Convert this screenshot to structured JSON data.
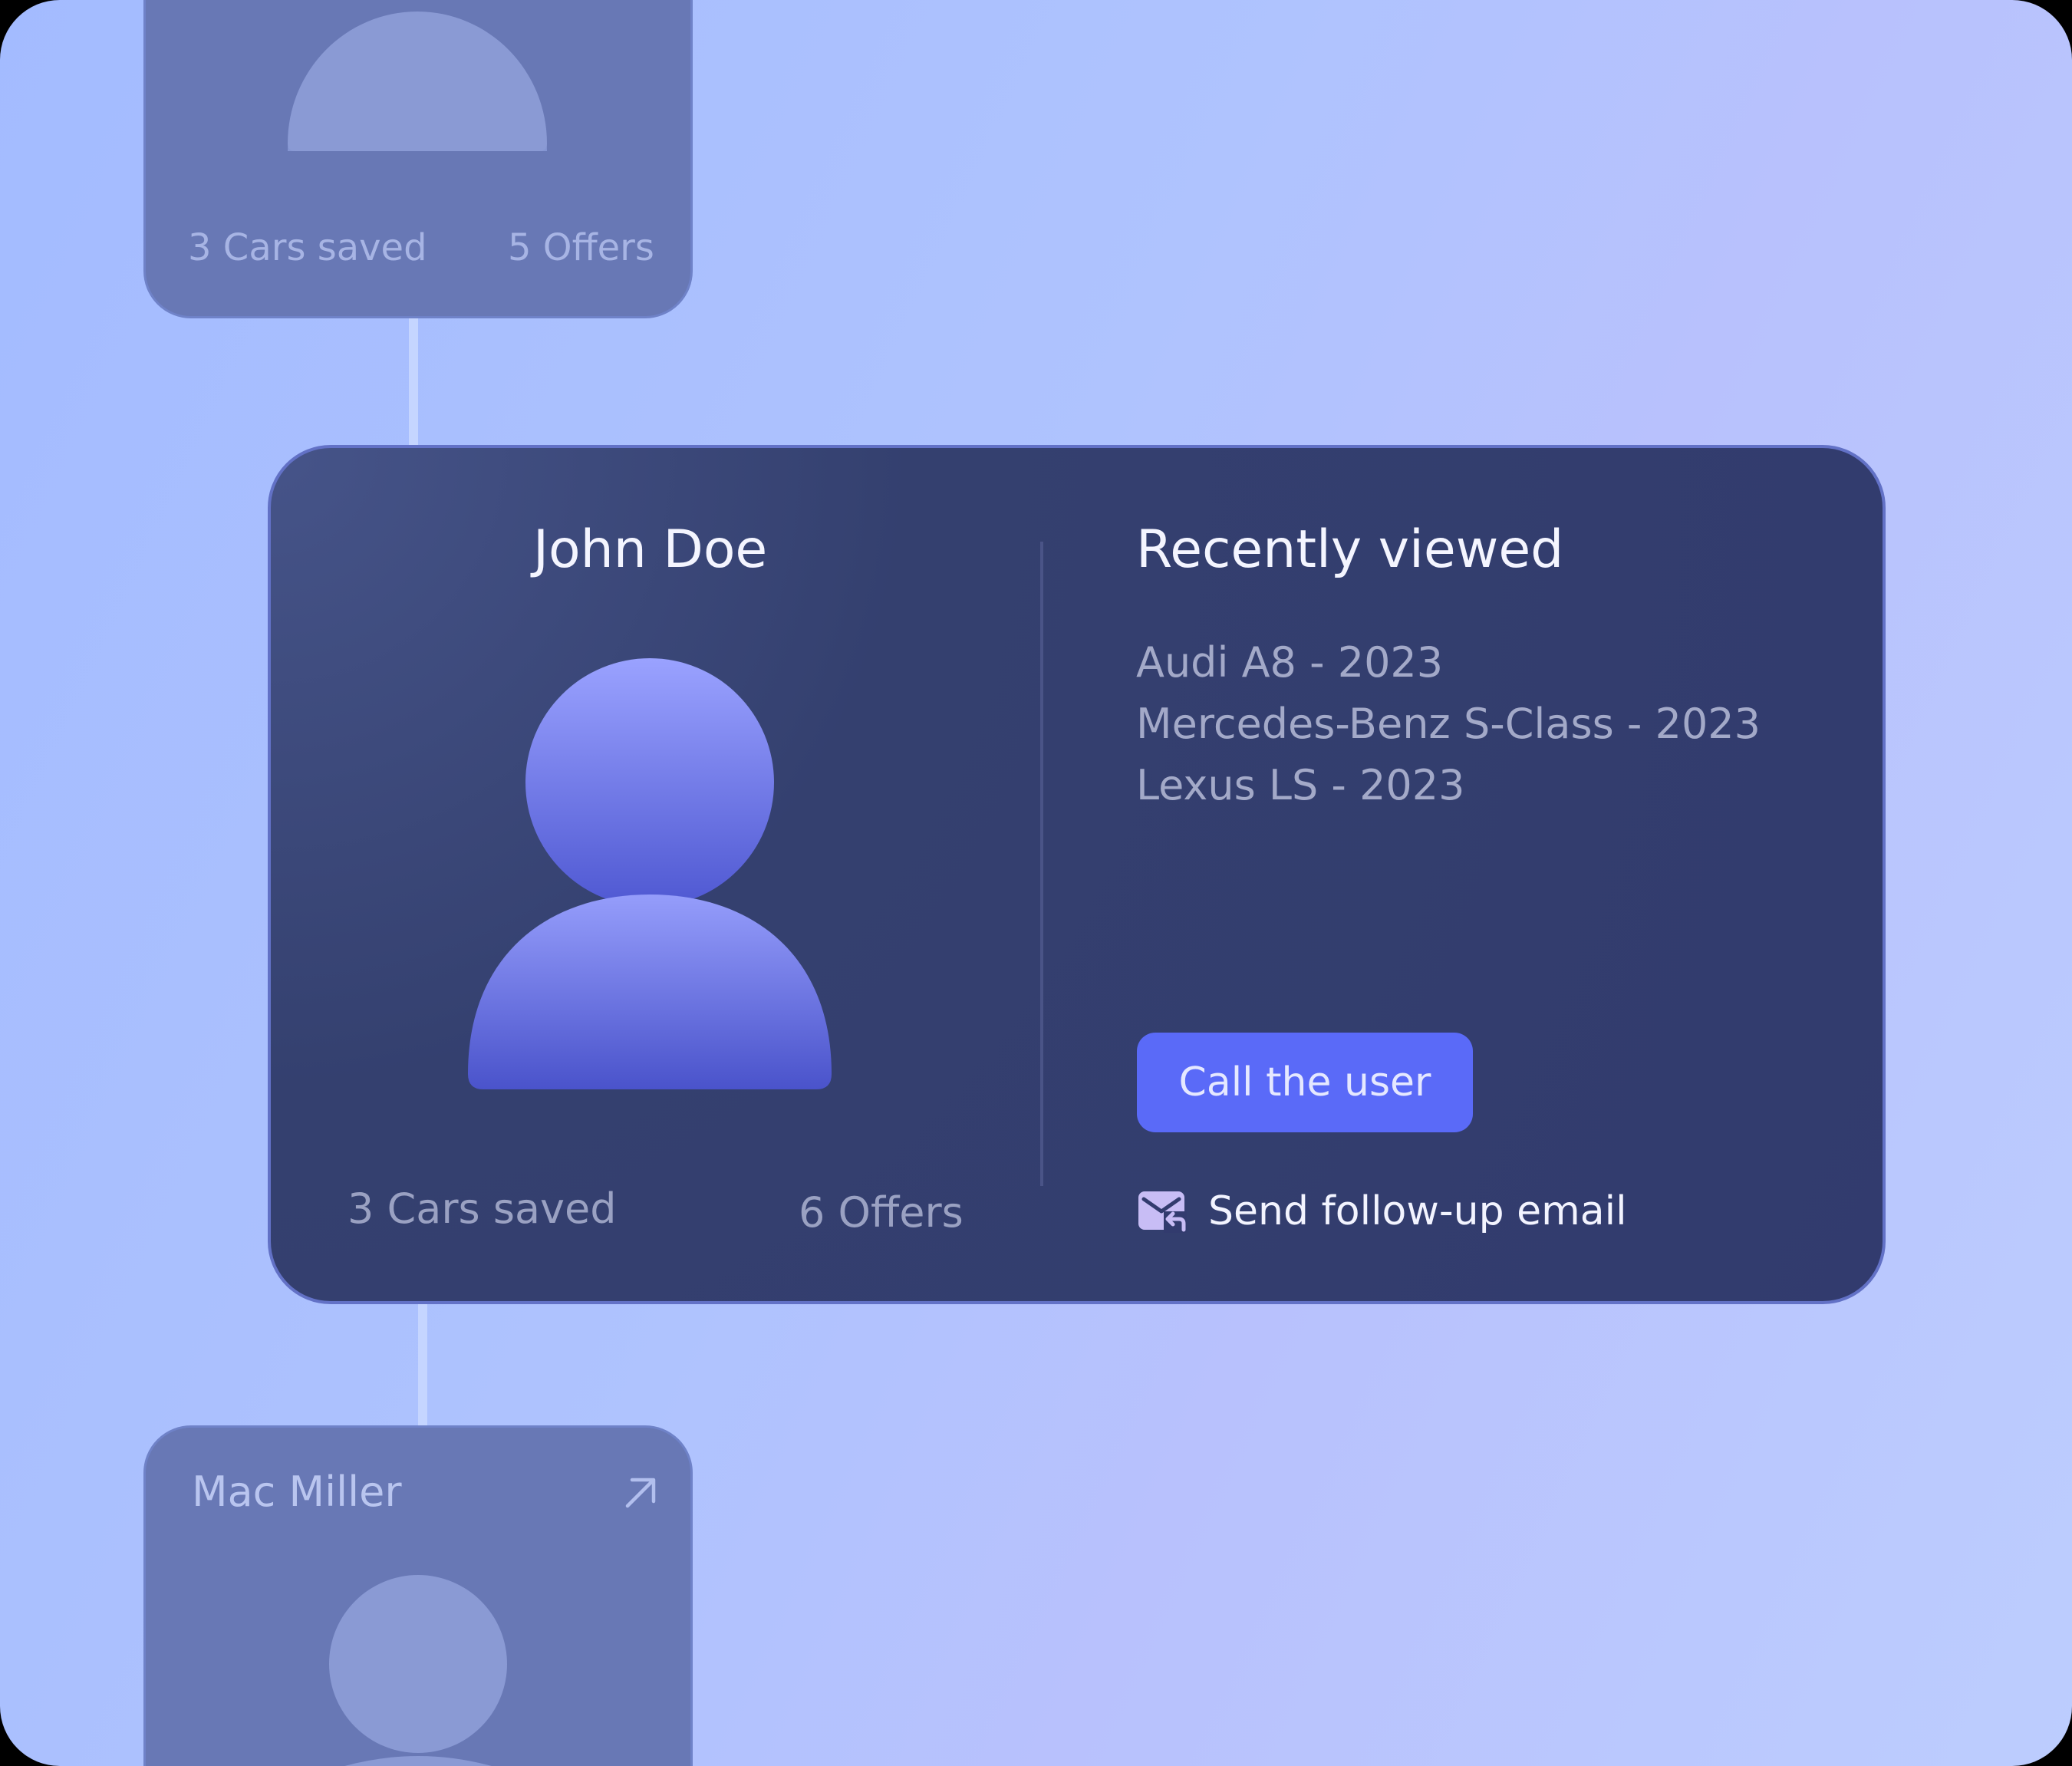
{
  "top_card": {
    "cars_saved": "3 Cars saved",
    "offers": "5 Offers"
  },
  "main_card": {
    "name": "John Doe",
    "cars_saved": "3 Cars saved",
    "offers": "6 Offers",
    "recently_viewed": {
      "title": "Recently viewed",
      "items": [
        "Audi A8 - 2023",
        "Mercedes-Benz S-Class - 2023",
        "Lexus LS - 2023"
      ]
    },
    "call_button": "Call the user",
    "email_action": {
      "label": "Send follow-up email",
      "icon": "mail-reply-icon"
    }
  },
  "bottom_card": {
    "name": "Mac Miller",
    "icon": "arrow-up-right-icon"
  },
  "colors": {
    "accent": "#5a6af8",
    "card": "#323b6e",
    "avatar_top": "#9aa2ff",
    "avatar_bottom": "#4d56cf",
    "background": "#a9bdfd"
  }
}
